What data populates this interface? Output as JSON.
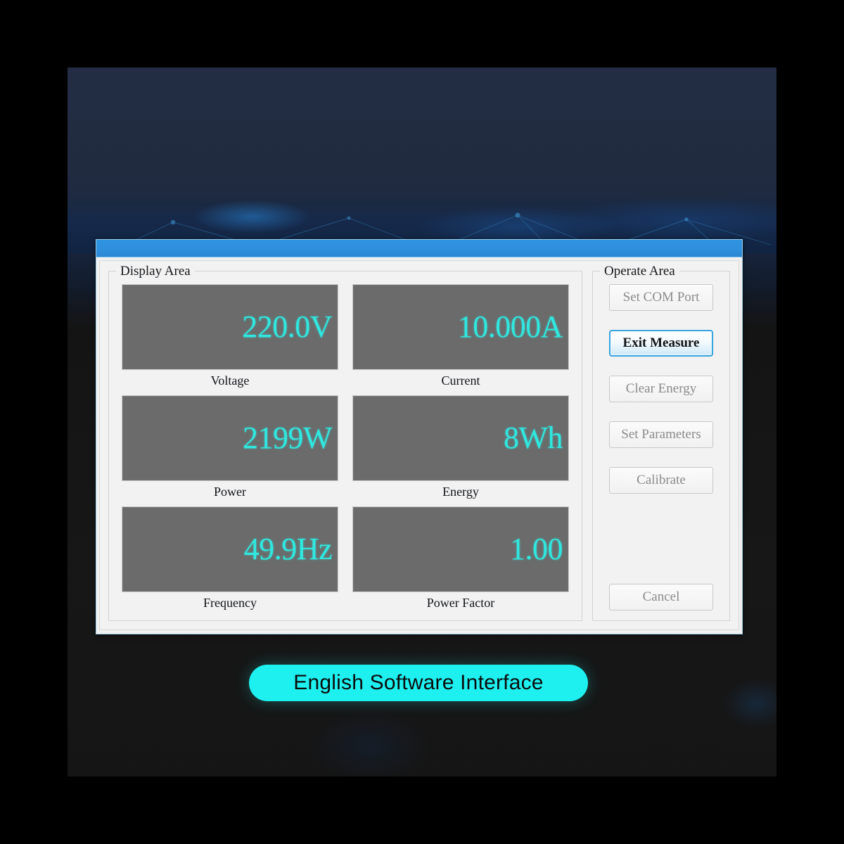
{
  "window": {
    "titlebar_label": "",
    "accent_color": "#2e93e0"
  },
  "display_area": {
    "title": "Display Area",
    "meters": [
      {
        "value": "220.0V",
        "label": "Voltage"
      },
      {
        "value": "10.000A",
        "label": "Current"
      },
      {
        "value": "2199W",
        "label": "Power"
      },
      {
        "value": "8Wh",
        "label": "Energy"
      },
      {
        "value": "49.9Hz",
        "label": "Frequency"
      },
      {
        "value": "1.00",
        "label": "Power Factor"
      }
    ],
    "value_color": "#2fe8e0",
    "value_background": "#6b6b6b"
  },
  "operate_area": {
    "title": "Operate Area",
    "buttons": [
      {
        "label": "Set COM Port",
        "state": "disabled"
      },
      {
        "label": "Exit Measure",
        "state": "active"
      },
      {
        "label": "Clear Energy",
        "state": "disabled"
      },
      {
        "label": "Set Parameters",
        "state": "disabled"
      },
      {
        "label": "Calibrate",
        "state": "disabled"
      },
      {
        "label": "Cancel",
        "state": "disabled"
      }
    ],
    "active_color": "#36a4e0"
  },
  "caption": {
    "text": "English Software Interface",
    "pill_color": "#1ef0f0"
  }
}
